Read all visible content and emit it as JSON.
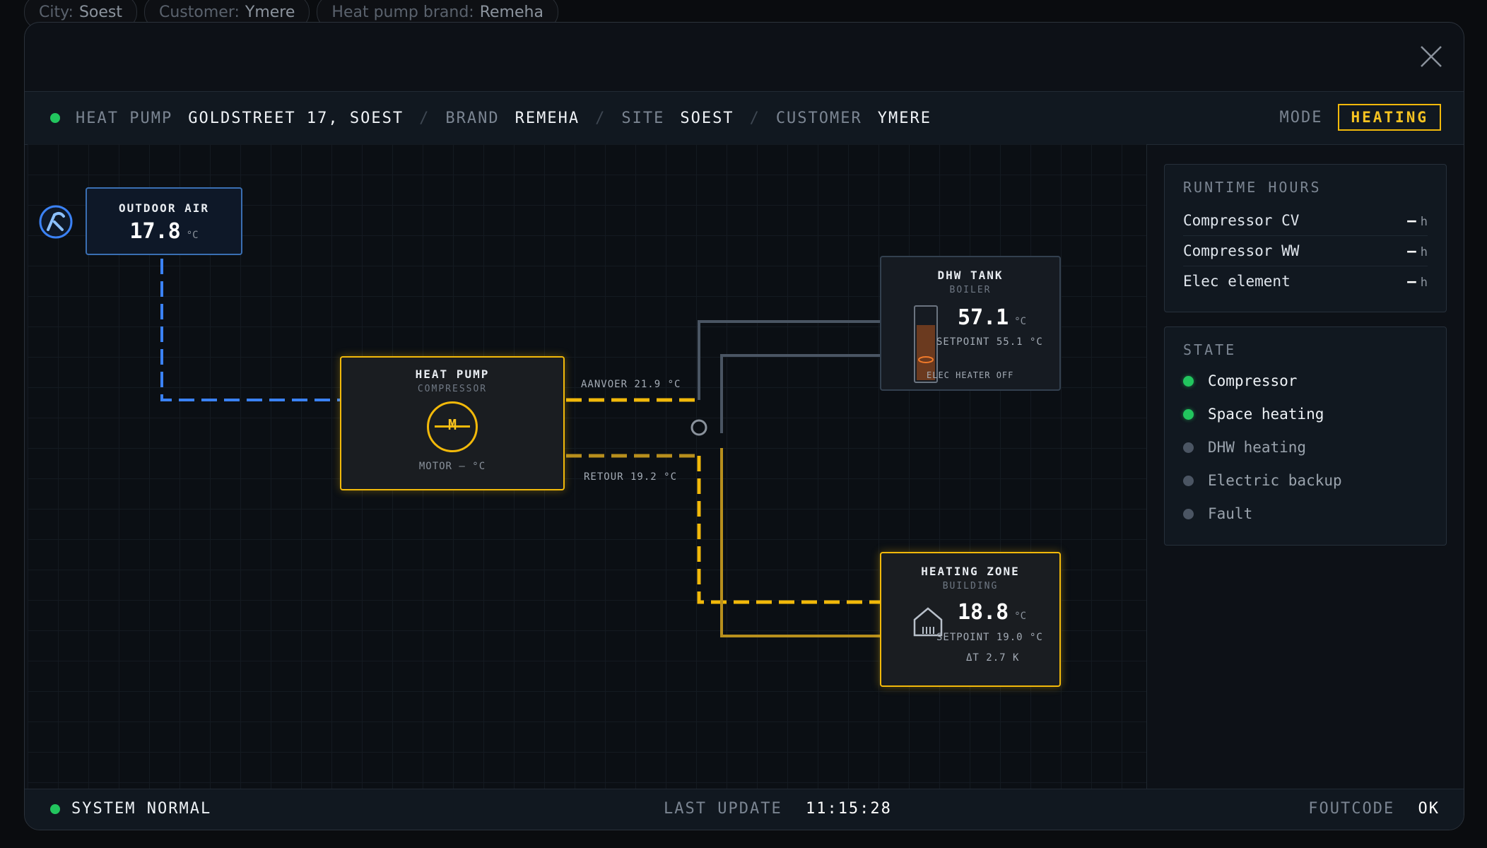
{
  "background_chips": [
    {
      "key": "City:",
      "value": "Soest"
    },
    {
      "key": "Customer:",
      "value": "Ymere"
    },
    {
      "key": "Heat pump brand:",
      "value": "Remeha"
    }
  ],
  "header": {
    "heat_pump_label": "HEAT PUMP",
    "heat_pump_value": "GOLDSTREET 17, SOEST",
    "brand_label": "BRAND",
    "brand_value": "REMEHA",
    "site_label": "SITE",
    "site_value": "SOEST",
    "customer_label": "CUSTOMER",
    "customer_value": "YMERE",
    "separator": "/",
    "mode_label": "MODE",
    "mode_value": "HEATING"
  },
  "diagram": {
    "outdoor": {
      "title": "OUTDOOR AIR",
      "value": "17.8",
      "unit": "°C"
    },
    "heat_pump": {
      "title": "HEAT PUMP",
      "subtitle": "COMPRESSOR",
      "motor_glyph": "M",
      "motor_text": "MOTOR — °C"
    },
    "supply_label": "AANVOER 21.9 °C",
    "return_label": "RETOUR 19.2 °C",
    "dhw": {
      "title": "DHW TANK",
      "subtitle": "BOILER",
      "value": "57.1",
      "unit": "°C",
      "setpoint": "SETPOINT 55.1 °C",
      "heater": "ELEC HEATER OFF"
    },
    "zone": {
      "title": "HEATING ZONE",
      "subtitle": "BUILDING",
      "value": "18.8",
      "unit": "°C",
      "setpoint": "SETPOINT 19.0 °C",
      "delta": "ΔT 2.7 K"
    }
  },
  "runtime": {
    "title": "RUNTIME HOURS",
    "rows": [
      {
        "label": "Compressor CV",
        "value": "—",
        "unit": "h"
      },
      {
        "label": "Compressor WW",
        "value": "—",
        "unit": "h"
      },
      {
        "label": "Elec element",
        "value": "—",
        "unit": "h"
      }
    ]
  },
  "state": {
    "title": "STATE",
    "items": [
      {
        "label": "Compressor",
        "on": true
      },
      {
        "label": "Space heating",
        "on": true
      },
      {
        "label": "DHW heating",
        "on": false
      },
      {
        "label": "Electric backup",
        "on": false
      },
      {
        "label": "Fault",
        "on": false
      }
    ]
  },
  "footer": {
    "status": "SYSTEM NORMAL",
    "last_update_label": "LAST UPDATE",
    "last_update_value": "11:15:28",
    "faultcode_label": "FOUTCODE",
    "faultcode_value": "OK"
  },
  "colors": {
    "accent": "#f2b90a",
    "ok": "#22c55e",
    "cold": "#3b82f6"
  }
}
